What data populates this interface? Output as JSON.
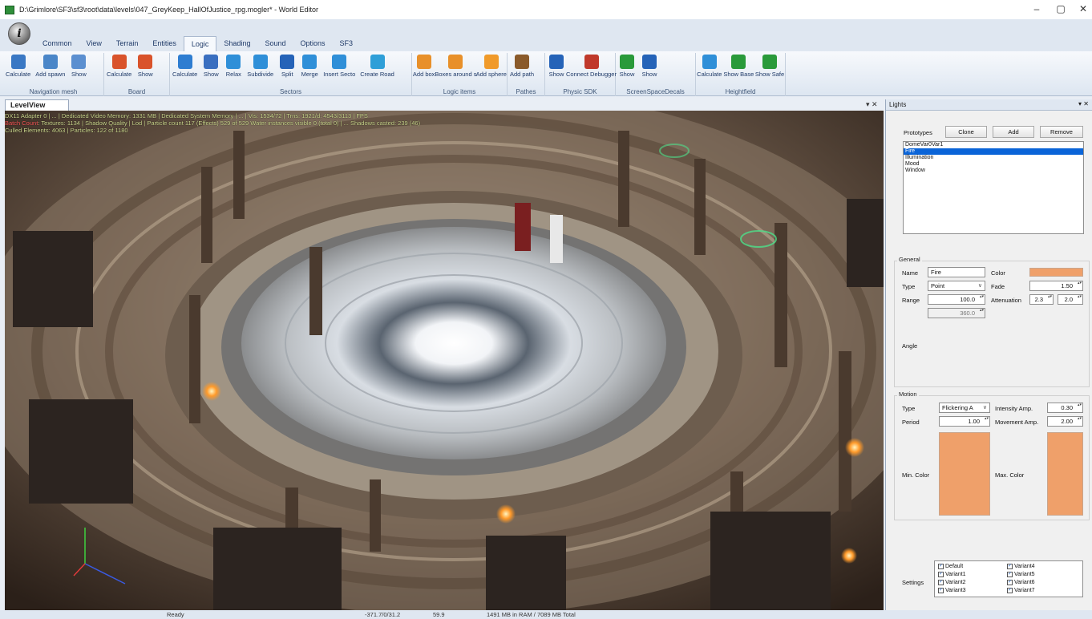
{
  "window": {
    "title": "D:\\Grimlore\\SF3\\sf3\\root\\data\\levels\\047_GreyKeep_HallOfJustice_rpg.mogler* - World Editor",
    "controls": [
      "–",
      "▢",
      "✕"
    ]
  },
  "app_orb": "i",
  "ribbon_tabs": [
    {
      "label": "Common",
      "active": false
    },
    {
      "label": "View",
      "active": false
    },
    {
      "label": "Terrain",
      "active": false
    },
    {
      "label": "Entities",
      "active": false
    },
    {
      "label": "Logic",
      "active": true
    },
    {
      "label": "Shading",
      "active": false
    },
    {
      "label": "Sound",
      "active": false
    },
    {
      "label": "Options",
      "active": false
    },
    {
      "label": "SF3",
      "active": false
    }
  ],
  "ribbon_groups": [
    {
      "name": "Navigation mesh",
      "buttons": [
        {
          "label": "Calculate",
          "icon": "calculator-icon",
          "color": "#3a78c4"
        },
        {
          "label": "Add spawn",
          "icon": "spawn-icon",
          "color": "#4a86c8"
        },
        {
          "label": "Show",
          "icon": "grid-icon",
          "color": "#5b8fd0"
        }
      ]
    },
    {
      "name": "Board",
      "buttons": [
        {
          "label": "Calculate",
          "icon": "board-calc-icon",
          "color": "#d9532b"
        },
        {
          "label": "Show",
          "icon": "board-show-icon",
          "color": "#d9532b"
        }
      ]
    },
    {
      "name": "Sectors",
      "buttons": [
        {
          "label": "Calculate",
          "icon": "sector-calc-icon",
          "color": "#2e7dd1"
        },
        {
          "label": "Show",
          "icon": "sector-show-icon",
          "color": "#3a6fc0"
        },
        {
          "label": "Relax",
          "icon": "relax-icon",
          "color": "#2f8fd8"
        },
        {
          "label": "Subdivide",
          "icon": "subdivide-icon",
          "color": "#2f8fd8"
        },
        {
          "label": "Split",
          "icon": "split-icon",
          "color": "#2563b8"
        },
        {
          "label": "Merge",
          "icon": "merge-icon",
          "color": "#2f8fd8"
        },
        {
          "label": "Insert Secto",
          "icon": "insert-sector-icon",
          "color": "#2f8fd8"
        },
        {
          "label": "Create Road",
          "icon": "road-icon",
          "color": "#2f9fd8"
        }
      ]
    },
    {
      "name": "Logic items",
      "buttons": [
        {
          "label": "Add box",
          "icon": "box-icon",
          "color": "#e8902a"
        },
        {
          "label": "Boxes around s",
          "icon": "boxes-icon",
          "color": "#e8902a"
        },
        {
          "label": "Add sphere",
          "icon": "sphere-icon",
          "color": "#f09a2a"
        }
      ]
    },
    {
      "name": "Pathes",
      "buttons": [
        {
          "label": "Add path",
          "icon": "signpost-icon",
          "color": "#8a5a2a"
        }
      ]
    },
    {
      "name": "Physic SDK",
      "buttons": [
        {
          "label": "Show",
          "icon": "physics-show-icon",
          "color": "#2563b8"
        },
        {
          "label": "Connect Debugger",
          "icon": "bug-icon",
          "color": "#c0392b"
        }
      ]
    },
    {
      "name": "ScreenSpaceDecals",
      "buttons": [
        {
          "label": "Show",
          "icon": "decal-icon",
          "color": "#2a9a3a"
        },
        {
          "label": "Show",
          "icon": "decal2-icon",
          "color": "#2563b8"
        }
      ]
    },
    {
      "name": "Heightfield",
      "buttons": [
        {
          "label": "Calculate",
          "icon": "heightfield-icon",
          "color": "#2f8fd8"
        },
        {
          "label": "Show Base",
          "icon": "base-icon",
          "color": "#2a9a3a"
        },
        {
          "label": "Show Safe",
          "icon": "safe-icon",
          "color": "#2a9a3a"
        }
      ]
    }
  ],
  "viewport": {
    "tab_label": "LevelView",
    "close_label": "▾ ✕",
    "stats_line1": "DX11 Adapter 0 | ... | Dedicated Video Memory: 1331 MB | Dedicated System Memory | ... | Vis: 1534/72 | Trns: 1921/d: 4543/3113 | FPS",
    "stats_line2_red": "Batch Count",
    "stats_line2": ": Textures: 1134 | Shadow Quality | Lod | Particle count 117 (Effects) 529 of 529 Water instances visible 0 (total 0) | ... Shadows casted: 239 (46)",
    "stats_line3": "Culled Elements: 4063 | Particles: 122 of 1180"
  },
  "lights_panel": {
    "title": "Lights",
    "pin": "▾ ✕",
    "prototypes_label": "Prototypes",
    "buttons": [
      "Clone",
      "Add",
      "Remove"
    ],
    "prototypes": [
      {
        "label": "DomeVar0Var1",
        "selected": false
      },
      {
        "label": "Fire",
        "selected": true
      },
      {
        "label": "Illumination",
        "selected": false
      },
      {
        "label": "Mood",
        "selected": false
      },
      {
        "label": "Window",
        "selected": false
      }
    ],
    "general": {
      "legend": "General",
      "name_label": "Name",
      "name_value": "Fire",
      "color_label": "Color",
      "color": "#efa06a",
      "type_label": "Type",
      "type_value": "Point",
      "fade_label": "Fade",
      "fade_value": "1.50",
      "range_label": "Range",
      "range_value": "100.0",
      "attenuation_label": "Attenuation",
      "attenuation_a": "2.3",
      "attenuation_b": "2.0",
      "disabled_value": "360.0",
      "angle_label": "Angle"
    },
    "motion": {
      "legend": "Motion",
      "type_label": "Type",
      "type_value": "Flickering A",
      "intensity_label": "Intensity Amp.",
      "intensity_value": "0.30",
      "period_label": "Period",
      "period_value": "1.00",
      "movement_label": "Movement Amp.",
      "movement_value": "2.00",
      "min_color_label": "Min. Color",
      "max_color_label": "Max. Color",
      "min_color": "#efa06a",
      "max_color": "#efa06a"
    },
    "settings": {
      "label": "Settings",
      "variants": [
        {
          "label": "Default",
          "checked": true
        },
        {
          "label": "Variant1",
          "checked": true
        },
        {
          "label": "Variant2",
          "checked": true
        },
        {
          "label": "Variant3",
          "checked": true
        },
        {
          "label": "Variant4",
          "checked": true
        },
        {
          "label": "Variant5",
          "checked": true
        },
        {
          "label": "Variant6",
          "checked": true
        },
        {
          "label": "Variant7",
          "checked": true
        }
      ]
    }
  },
  "statusbar": {
    "status": "Ready",
    "coords": "-371.7/0/31.2",
    "fps": "59.9",
    "memory": "1491 MB in RAM / 7089 MB Total"
  }
}
